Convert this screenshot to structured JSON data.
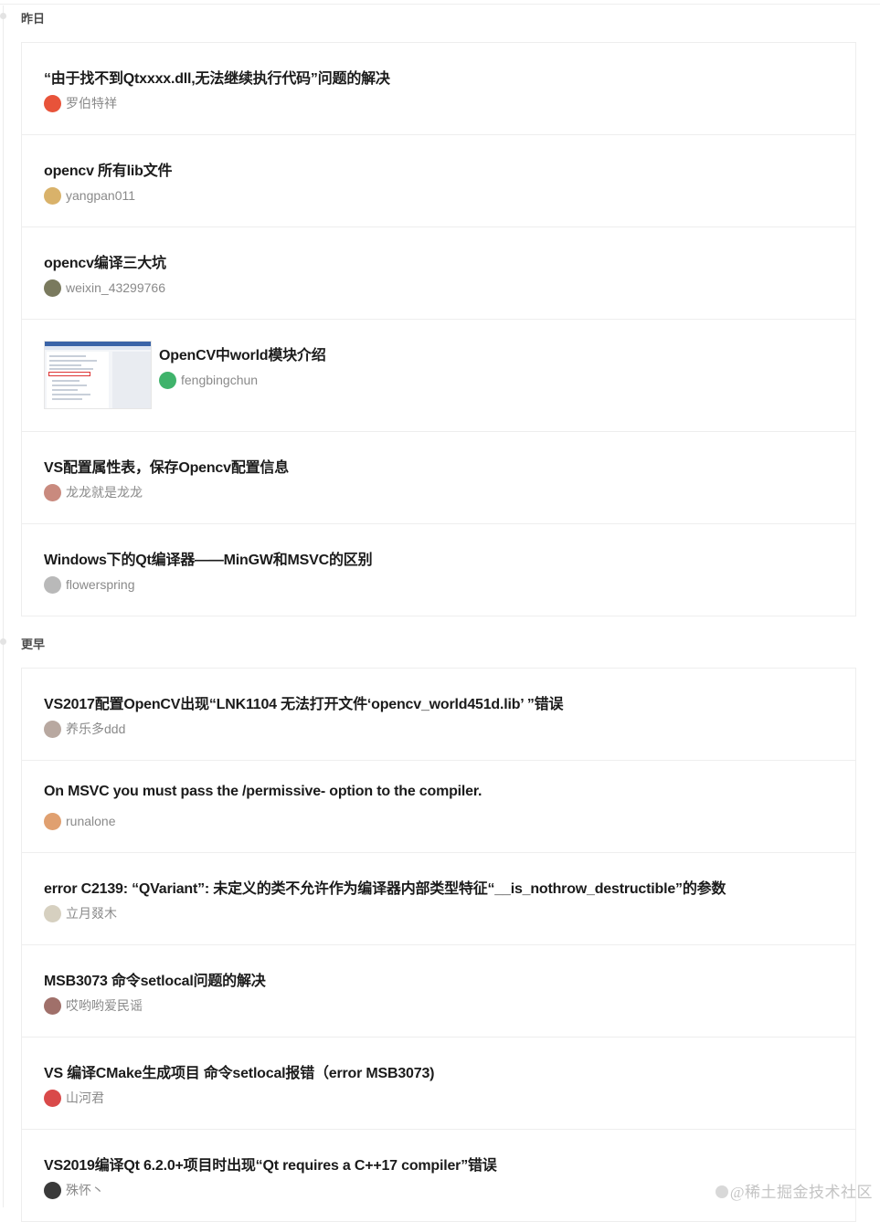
{
  "groups": [
    {
      "label": "昨日",
      "items": [
        {
          "title": "“由于找不到Qtxxxx.dll,无法继续执行代码”问题的解决",
          "author": "罗伯特祥",
          "avatar_color": "#e8533a"
        },
        {
          "title": "opencv 所有lib文件",
          "author": "yangpan011",
          "avatar_color": "#d9b26a"
        },
        {
          "title": "opencv编译三大坑",
          "author": "weixin_43299766",
          "avatar_color": "#7a7a5e"
        },
        {
          "title": "OpenCV中world模块介绍",
          "author": "fengbingchun",
          "avatar_color": "#3fb36b",
          "has_thumbnail": true
        },
        {
          "title": "VS配置属性表，保存Opencv配置信息",
          "author": "龙龙就是龙龙",
          "avatar_color": "#c98a7e"
        },
        {
          "title": "Windows下的Qt编译器——MinGW和MSVC的区别",
          "author": "flowerspring",
          "avatar_color": "#b9b9b9"
        }
      ]
    },
    {
      "label": "更早",
      "items": [
        {
          "title": "VS2017配置OpenCV出现“LNK1104 无法打开文件‘opencv_world451d.lib’ ”错误",
          "author": "养乐多ddd",
          "avatar_color": "#b8a8a0"
        },
        {
          "title": "On MSVC you must pass the /permissive- option to the compiler.",
          "author": "runalone",
          "avatar_color": "#e0a070"
        },
        {
          "title": "error C2139: “QVariant”: 未定义的类不允许作为编译器内部类型特征“__is_nothrow_destructible”的参数",
          "author": "立月叕木",
          "avatar_color": "#d6d0c0"
        },
        {
          "title": "MSB3073 命令setlocal问题的解决",
          "author": "哎哟哟爱民谣",
          "avatar_color": "#a0706a"
        },
        {
          "title": "VS 编译CMake生成项目 命令setlocal报错（error MSB3073)",
          "author": "山河君",
          "avatar_color": "#d94a4a"
        },
        {
          "title": "VS2019编译Qt 6.2.0+项目时出现“Qt requires a C++17 compiler”错误",
          "author": "殊怀丶",
          "avatar_color": "#3a3a3a"
        }
      ]
    }
  ],
  "watermark": "@稀土掘金技术社区"
}
